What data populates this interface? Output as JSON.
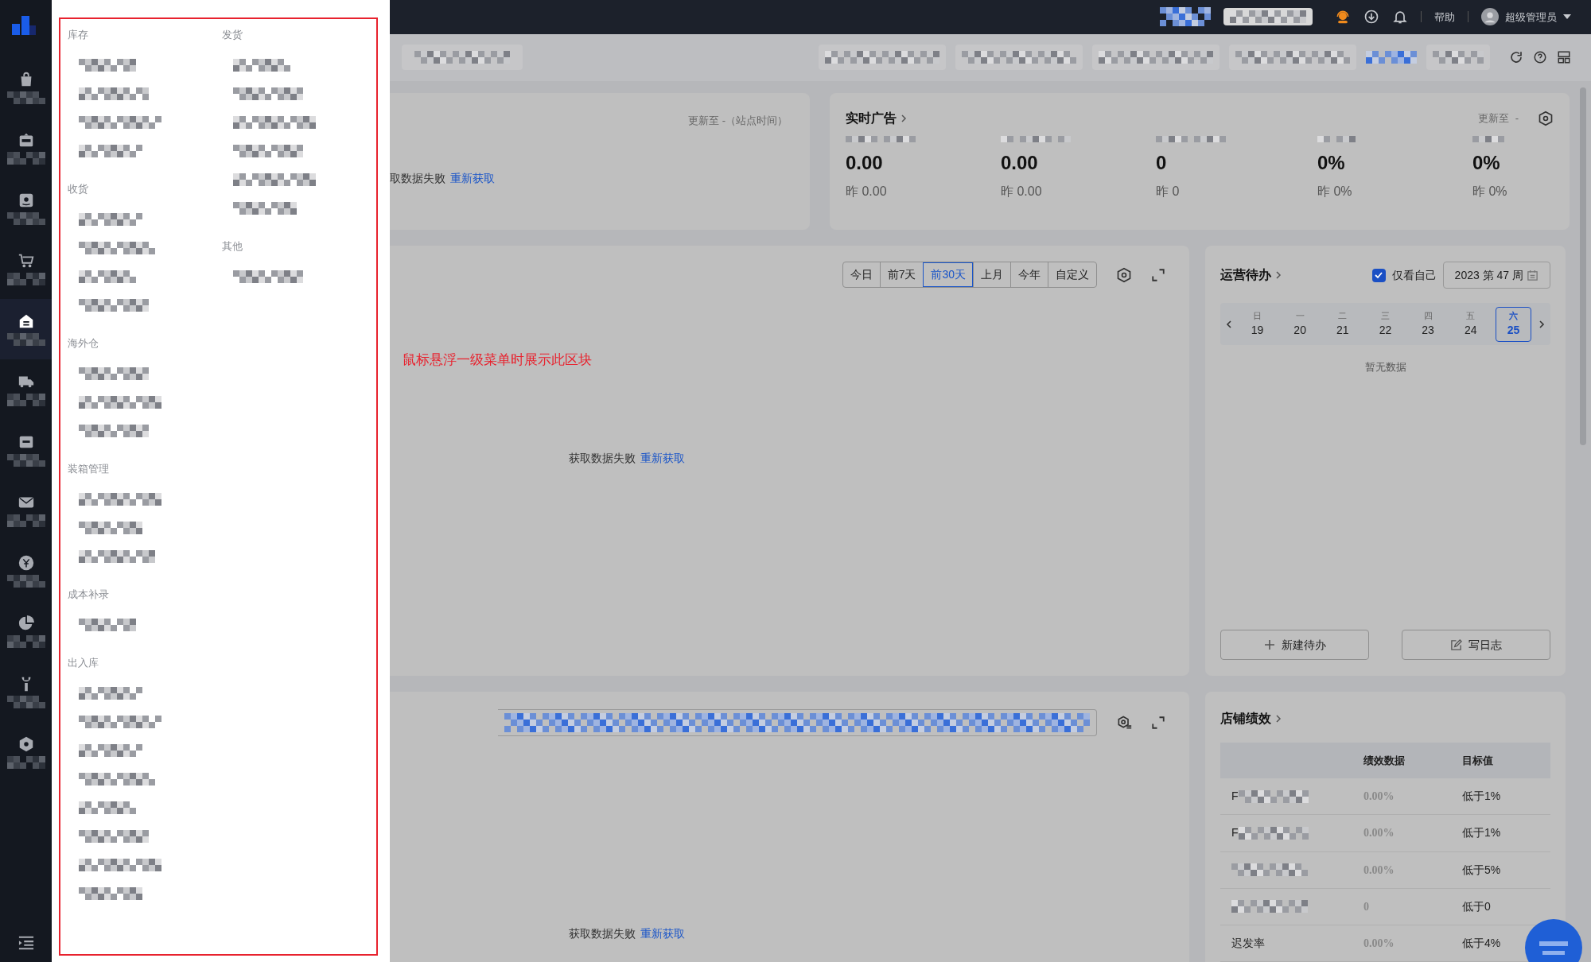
{
  "sidebar": {
    "items": [
      {
        "kind": "bag",
        "selected": false
      },
      {
        "kind": "sel",
        "selected": false
      },
      {
        "kind": "amazon",
        "selected": false
      },
      {
        "kind": "cart",
        "selected": false
      },
      {
        "kind": "warehouse",
        "selected": true
      },
      {
        "kind": "truck",
        "selected": false
      },
      {
        "kind": "ad",
        "selected": false
      },
      {
        "kind": "mail",
        "selected": false
      },
      {
        "kind": "money",
        "selected": false
      },
      {
        "kind": "pie",
        "selected": false
      },
      {
        "kind": "wrench",
        "selected": false
      },
      {
        "kind": "hexagon",
        "selected": false
      }
    ]
  },
  "flyout": {
    "columns": [
      [
        {
          "heading": "库存",
          "items": [
            {
              "kind": "redacted"
            },
            {
              "kind": "redacted"
            },
            {
              "kind": "redacted"
            },
            {
              "kind": "redacted"
            }
          ]
        },
        {
          "heading": "收货",
          "items": [
            {
              "kind": "redacted"
            },
            {
              "kind": "redacted"
            },
            {
              "kind": "redacted"
            },
            {
              "kind": "redacted"
            }
          ]
        },
        {
          "heading": "海外仓",
          "items": [
            {
              "kind": "redacted"
            },
            {
              "kind": "redacted"
            },
            {
              "kind": "redacted"
            }
          ]
        },
        {
          "heading": "装箱管理",
          "items": [
            {
              "kind": "redacted"
            },
            {
              "kind": "redacted"
            },
            {
              "kind": "redacted"
            }
          ]
        },
        {
          "heading": "成本补录",
          "items": [
            {
              "kind": "redacted"
            }
          ]
        },
        {
          "heading": "出入库",
          "items": [
            {
              "kind": "redacted"
            },
            {
              "kind": "redacted"
            },
            {
              "kind": "redacted"
            },
            {
              "kind": "redacted"
            },
            {
              "kind": "redacted"
            },
            {
              "kind": "redacted"
            },
            {
              "kind": "redacted"
            },
            {
              "kind": "redacted"
            }
          ]
        }
      ],
      [
        {
          "heading": "发货",
          "items": [
            {
              "kind": "redacted"
            },
            {
              "kind": "redacted"
            },
            {
              "kind": "redacted"
            },
            {
              "kind": "redacted"
            },
            {
              "kind": "redacted"
            },
            {
              "kind": "redacted"
            }
          ]
        },
        {
          "heading": "其他",
          "items": [
            {
              "kind": "redacted"
            }
          ]
        }
      ]
    ]
  },
  "top_bar": {
    "help": "帮助",
    "user": "超级管理员"
  },
  "sales_card": {
    "updated": "更新至 -（站点时间）",
    "error": "取数据失败",
    "retry": "重新获取"
  },
  "ad_card": {
    "title": "实时广告",
    "updated": "更新至  -",
    "metrics": [
      {
        "value": "0.00",
        "yesterday": "昨 0.00"
      },
      {
        "value": "0.00",
        "yesterday": "昨 0.00"
      },
      {
        "value": "0",
        "yesterday": "昨 0"
      },
      {
        "value": "0%",
        "yesterday": "昨 0%"
      },
      {
        "value": "0%",
        "yesterday": "昨 0%"
      }
    ]
  },
  "trend_card": {
    "ranges": [
      {
        "label": "今日",
        "selected": false
      },
      {
        "label": "前7天",
        "selected": false
      },
      {
        "label": "前30天",
        "selected": true
      },
      {
        "label": "上月",
        "selected": false
      },
      {
        "label": "今年",
        "selected": false
      },
      {
        "label": "自定义",
        "selected": false
      }
    ],
    "note": "鼠标悬浮一级菜单时展示此区块",
    "error": "获取数据失败",
    "retry": "重新获取"
  },
  "todo_card": {
    "title": "运营待办",
    "only_mine": {
      "label": "仅看自己",
      "checked": true
    },
    "week": "2023 第 47 周",
    "days": [
      {
        "weekday": "日",
        "date": "19",
        "selected": false
      },
      {
        "weekday": "一",
        "date": "20",
        "selected": false
      },
      {
        "weekday": "二",
        "date": "21",
        "selected": false
      },
      {
        "weekday": "三",
        "date": "22",
        "selected": false
      },
      {
        "weekday": "四",
        "date": "23",
        "selected": false
      },
      {
        "weekday": "五",
        "date": "24",
        "selected": false
      },
      {
        "weekday": "六",
        "date": "25",
        "selected": true
      }
    ],
    "empty": "暂无数据",
    "buttons": [
      "新建待办",
      "写日志"
    ]
  },
  "bottom_card": {
    "error": "获取数据失败",
    "retry": "重新获取"
  },
  "performance_card": {
    "title": "店铺绩效",
    "columns": [
      "绩效数据",
      "目标值"
    ],
    "rows": [
      {
        "name": "F",
        "value": "0.00%",
        "target": "低于1%"
      },
      {
        "name": "F",
        "value": "0.00%",
        "target": "低于1%"
      },
      {
        "value": "0.00%",
        "target": "低于5%"
      },
      {
        "value": "0",
        "target": "低于0"
      },
      {
        "name": "迟发率",
        "value": "0.00%",
        "target": "低于4%"
      }
    ]
  }
}
